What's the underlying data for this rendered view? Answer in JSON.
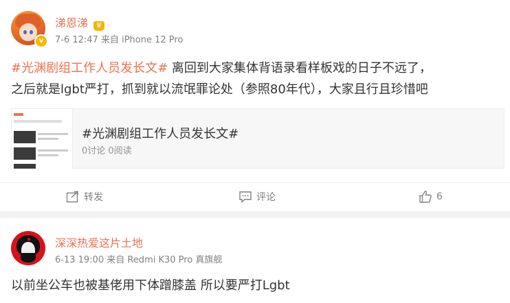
{
  "post": {
    "author": "涕恩涕",
    "meta": "7-6 12:47 来自 iPhone 12 Pro",
    "topic_tag": "#光渊剧组工作人员发长文#",
    "text_line1": " 离回到大家集体背语录看样板戏的日子不远了，",
    "text_line2": "之后就是lgbt严打，抓到就以流氓罪论处（参照80年代），大家且行且珍惜吧",
    "topic_card": {
      "title": "#光渊剧组工作人员发长文#",
      "stats": "0讨论 0阅读"
    },
    "actions": {
      "repost_label": "转发",
      "comment_label": "评论",
      "like_count": "6"
    }
  },
  "reply": {
    "author": "深深热爱这片土地",
    "meta": "6-13 19:00 来自 Redmi K30 Pro 真旗舰",
    "text": "以前坐公车也被基佬用下体蹭膝盖 所以要严打Lgbt"
  },
  "colors": {
    "accent": "#eb7350",
    "meta_gray": "#808080",
    "text": "#333333"
  }
}
